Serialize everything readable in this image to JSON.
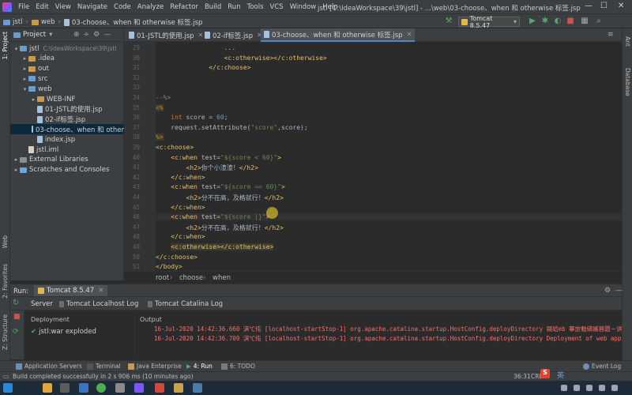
{
  "menubar": {
    "items": [
      "File",
      "Edit",
      "View",
      "Navigate",
      "Code",
      "Analyze",
      "Refactor",
      "Build",
      "Run",
      "Tools",
      "VCS",
      "Window",
      "Help"
    ],
    "title": "jstl [C:\\IdeaWorkspace\\39\\jstl] - ...\\web\\03-choose、when 和 otherwise 标签.jsp"
  },
  "navbar": {
    "crumbs": [
      "jstl",
      "web",
      "03-choose、when 和 otherwise 标签.jsp"
    ],
    "run_config": "Tomcat 8.5.47"
  },
  "left_stripe": {
    "project": "1: Project",
    "web": "Web",
    "favorites": "2: Favorites",
    "structure": "Z: Structure"
  },
  "right_stripe": {
    "ant": "Ant",
    "database": "Database"
  },
  "project_panel": {
    "title": "Project",
    "tree": [
      {
        "label": "jstl",
        "path": "C:\\IdeaWorkspace\\39\\jstl",
        "indent": 0,
        "kind": "module"
      },
      {
        "label": ".idea",
        "indent": 1,
        "kind": "folder"
      },
      {
        "label": "out",
        "indent": 1,
        "kind": "folder"
      },
      {
        "label": "src",
        "indent": 1,
        "kind": "folder"
      },
      {
        "label": "web",
        "indent": 1,
        "kind": "folder"
      },
      {
        "label": "WEB-INF",
        "indent": 2,
        "kind": "folder"
      },
      {
        "label": "01-JSTL的使用.jsp",
        "indent": 2,
        "kind": "jsp"
      },
      {
        "label": "02-if标签.jsp",
        "indent": 2,
        "kind": "jsp"
      },
      {
        "label": "03-choose、when 和 other",
        "indent": 2,
        "kind": "jsp",
        "selected": true
      },
      {
        "label": "index.jsp",
        "indent": 2,
        "kind": "jsp"
      },
      {
        "label": "jstl.iml",
        "indent": 1,
        "kind": "file"
      },
      {
        "label": "External Libraries",
        "indent": 0,
        "kind": "lib"
      },
      {
        "label": "Scratches and Consoles",
        "indent": 0,
        "kind": "scratch"
      }
    ]
  },
  "editor_tabs": [
    {
      "label": "01-JSTL的使用.jsp",
      "active": false
    },
    {
      "label": "02-if标签.jsp",
      "active": false
    },
    {
      "label": "03-choose、when 和 otherwise 标签.jsp",
      "active": true
    }
  ],
  "editor": {
    "line_numbers": [
      "29",
      "30",
      "31",
      "32",
      "33",
      "34",
      "35",
      "36",
      "37",
      "38",
      "39",
      "40",
      "41",
      "42",
      "43",
      "44",
      "45",
      "46",
      "47",
      "48",
      "49",
      "50",
      "51"
    ],
    "lines": [
      {
        "parts": [
          [
            "",
            "                  ..."
          ]
        ]
      },
      {
        "parts": [
          [
            "tag",
            "                  <c:otherwise></c:otherwise>"
          ]
        ]
      },
      {
        "parts": [
          [
            "tag",
            "              </c:choose>"
          ]
        ]
      },
      {
        "parts": [
          [
            "",
            ""
          ]
        ]
      },
      {
        "parts": [
          [
            "",
            ""
          ]
        ]
      },
      {
        "parts": [
          [
            "cmt",
            "--%>"
          ]
        ]
      },
      {
        "parts": [
          [
            "jspd",
            "<%"
          ]
        ]
      },
      {
        "parts": [
          [
            "kw",
            "    int "
          ],
          [
            "",
            "score = "
          ],
          [
            "num",
            "60"
          ],
          [
            "",
            ";"
          ]
        ]
      },
      {
        "parts": [
          [
            "",
            "    request.setAttribute("
          ],
          [
            "str",
            "\"score\""
          ],
          [
            "",
            ",score);"
          ]
        ]
      },
      {
        "parts": [
          [
            "jspd",
            "%>"
          ]
        ]
      },
      {
        "parts": [
          [
            "tag",
            "<c:choose>"
          ]
        ]
      },
      {
        "parts": [
          [
            "tag",
            "    <c:when "
          ],
          [
            "attr",
            "test="
          ],
          [
            "str",
            "\"${score < 60}\""
          ],
          [
            "tag",
            ">"
          ]
        ]
      },
      {
        "parts": [
          [
            "tag",
            "        <h2>"
          ],
          [
            "",
            "你个小渣渣！"
          ],
          [
            "tag",
            "</h2>"
          ]
        ]
      },
      {
        "parts": [
          [
            "tag",
            "    </c:when>"
          ]
        ]
      },
      {
        "parts": [
          [
            "tag",
            "    <c:when "
          ],
          [
            "attr",
            "test="
          ],
          [
            "str",
            "\"${score == 60}\""
          ],
          [
            "tag",
            ">"
          ]
        ]
      },
      {
        "parts": [
          [
            "tag",
            "        <h2>"
          ],
          [
            "",
            "分不在高，及格就行！"
          ],
          [
            "tag",
            "</h2>"
          ]
        ]
      },
      {
        "parts": [
          [
            "tag",
            "    </c:when>"
          ]
        ]
      },
      {
        "parts": [
          [
            "tag",
            "    <c:when "
          ],
          [
            "attr",
            "test="
          ],
          [
            "str",
            "\"${score |}\""
          ],
          [
            "tag",
            ">"
          ]
        ],
        "current": true
      },
      {
        "parts": [
          [
            "tag",
            "        <h2>"
          ],
          [
            "",
            "分不在高，及格就行！"
          ],
          [
            "tag",
            "</h2>"
          ]
        ]
      },
      {
        "parts": [
          [
            "tag",
            "    </c:when>"
          ]
        ]
      },
      {
        "parts": [
          [
            "",
            "    "
          ],
          [
            "hl-tag",
            "<c:otherwise>"
          ],
          [
            "hl-tag",
            "</c:otherwise>"
          ]
        ]
      },
      {
        "parts": [
          [
            "tag",
            "</c:choose>"
          ]
        ]
      },
      {
        "parts": [
          [
            "tag",
            "</body>"
          ]
        ]
      }
    ]
  },
  "editor_breadcrumb": [
    "root",
    "choose",
    "when"
  ],
  "run_panel": {
    "label": "Run:",
    "config": "Tomcat 8.5.47",
    "tabs": [
      "Server",
      "Tomcat Localhost Log",
      "Tomcat Catalina Log"
    ],
    "deployment_header": "Deployment",
    "output_header": "Output",
    "deployment_item": "jstl:war exploded",
    "log_lines": [
      "16-Jul-2020 14:42:36.660 淇℃伅 [localhost-startStop-1] org.apache.catalina.startup.HostConfig.deployDirectory 鎶婄eb 搴旂敤绋嬪簭閮ㄧ讲鍒扮洰褰",
      "16-Jul-2020 14:42:36.709 淇℃伅 [localhost-startStop-1] org.apache.catalina.startup.HostConfig.deployDirectory Deployment of web applica"
    ]
  },
  "bottom_tools": [
    "Application Servers",
    "Terminal",
    "Java Enterprise",
    "4: Run",
    "6: TODO",
    "Event Log"
  ],
  "status": {
    "message": "Build completed successfully in 2 s 906 ms (10 minutes ago)",
    "position": "36:31",
    "line_sep": "CRLF",
    "ime": "英"
  }
}
